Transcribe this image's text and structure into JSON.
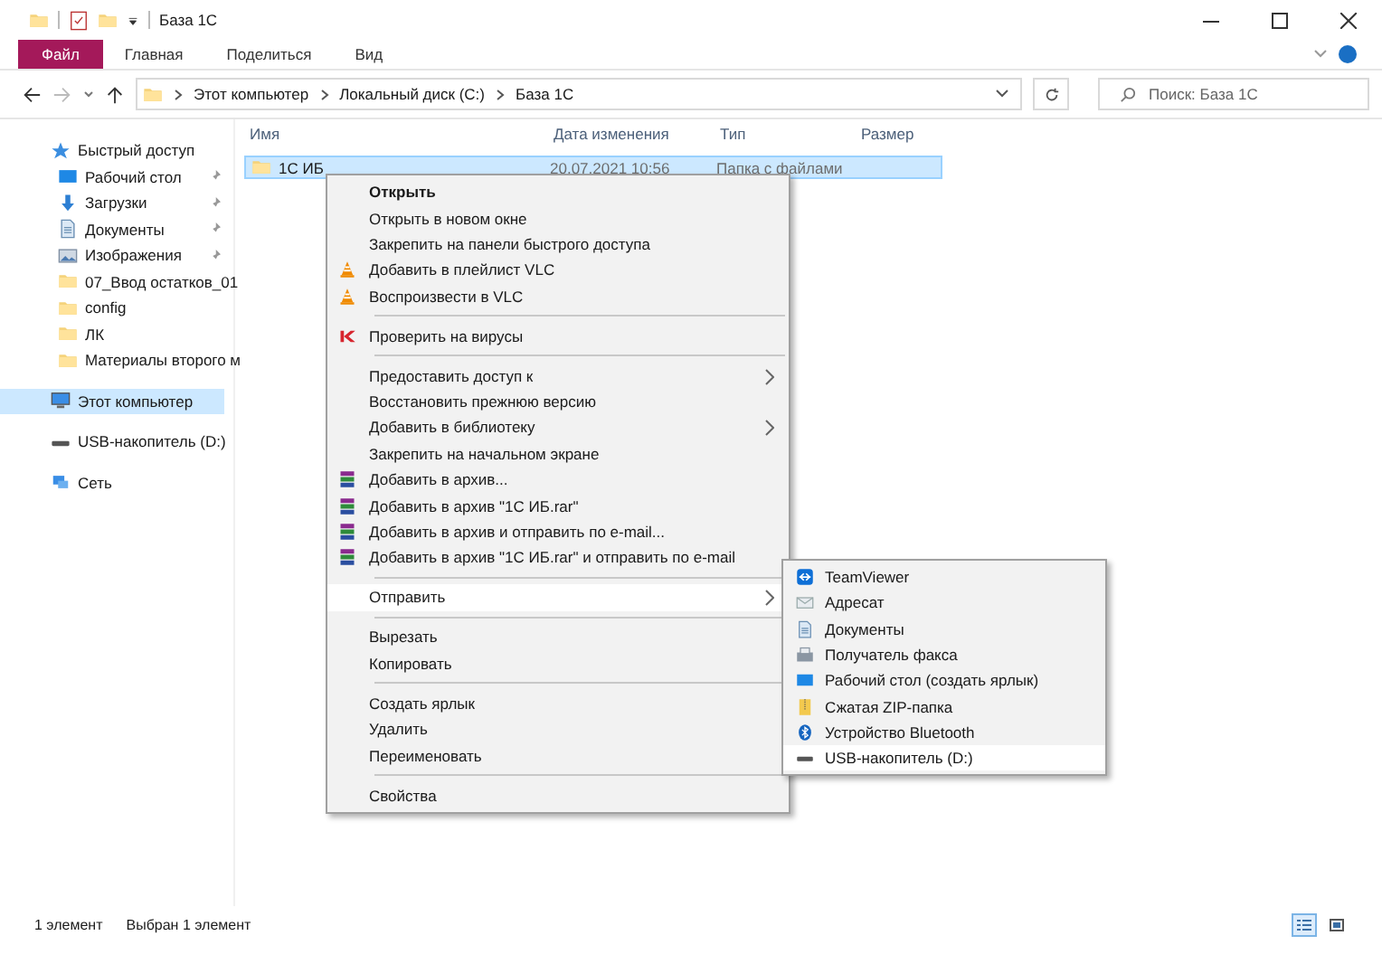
{
  "window": {
    "title": "База 1С"
  },
  "ribbon_tabs": [
    {
      "label": "Файл",
      "selected": true
    },
    {
      "label": "Главная",
      "selected": false
    },
    {
      "label": "Поделиться",
      "selected": false
    },
    {
      "label": "Вид",
      "selected": false
    }
  ],
  "address_bar": {
    "path": [
      "Этот компьютер",
      "Локальный диск (C:)",
      "База 1С"
    ]
  },
  "search": {
    "placeholder": "Поиск: База 1С"
  },
  "sidebar": {
    "items": [
      {
        "label": "Быстрый доступ",
        "selected": false,
        "children": [
          {
            "label": "Рабочий стол",
            "pinned": true,
            "selected": false
          },
          {
            "label": "Загрузки",
            "pinned": true,
            "selected": false
          },
          {
            "label": "Документы",
            "pinned": true,
            "selected": false
          },
          {
            "label": "Изображения",
            "pinned": true,
            "selected": false
          },
          {
            "label": "07_Ввод остатков_01",
            "pinned": false,
            "selected": false
          },
          {
            "label": "config",
            "pinned": false,
            "selected": false
          },
          {
            "label": "ЛК",
            "pinned": false,
            "selected": false
          },
          {
            "label": "Материалы второго м",
            "pinned": false,
            "selected": false
          }
        ]
      },
      {
        "label": "Этот компьютер",
        "selected": true
      },
      {
        "label": "USB-накопитель (D:)",
        "selected": false
      },
      {
        "label": "Сеть",
        "selected": false
      }
    ]
  },
  "table": {
    "columns": [
      "Имя",
      "Дата изменения",
      "Тип",
      "Размер"
    ],
    "rows": [
      {
        "name": "1С ИБ",
        "date": "20.07.2021 10:56",
        "type": "Папка с файлами",
        "selected": true
      }
    ]
  },
  "context_menu": {
    "items": [
      {
        "kind": "default",
        "label": "Открыть",
        "selected": false
      },
      {
        "kind": "item",
        "label": "Открыть в новом окне",
        "selected": false
      },
      {
        "kind": "item",
        "label": "Закрепить на панели быстрого доступа",
        "selected": false
      },
      {
        "kind": "item",
        "label": "Добавить в плейлист VLC",
        "selected": false
      },
      {
        "kind": "item",
        "label": "Воспроизвести в VLC",
        "selected": false
      },
      {
        "kind": "separator"
      },
      {
        "kind": "item",
        "label": "Проверить на вирусы",
        "selected": false
      },
      {
        "kind": "separator"
      },
      {
        "kind": "submenu",
        "label": "Предоставить доступ к",
        "selected": false
      },
      {
        "kind": "item",
        "label": "Восстановить прежнюю версию",
        "selected": false
      },
      {
        "kind": "submenu",
        "label": "Добавить в библиотеку",
        "selected": false
      },
      {
        "kind": "item",
        "label": "Закрепить на начальном экране",
        "selected": false
      },
      {
        "kind": "item",
        "label": "Добавить в архив...",
        "selected": false
      },
      {
        "kind": "item",
        "label": "Добавить в архив \"1С ИБ.rar\"",
        "selected": false
      },
      {
        "kind": "item",
        "label": "Добавить в архив и отправить по e-mail...",
        "selected": false
      },
      {
        "kind": "item",
        "label": "Добавить в архив \"1С ИБ.rar\" и отправить по e-mail",
        "selected": false
      },
      {
        "kind": "separator"
      },
      {
        "kind": "submenu",
        "label": "Отправить",
        "selected": true
      },
      {
        "kind": "separator"
      },
      {
        "kind": "item",
        "label": "Вырезать",
        "selected": false
      },
      {
        "kind": "item",
        "label": "Копировать",
        "selected": false
      },
      {
        "kind": "separator"
      },
      {
        "kind": "item",
        "label": "Создать ярлык",
        "selected": false
      },
      {
        "kind": "item",
        "label": "Удалить",
        "selected": false
      },
      {
        "kind": "item",
        "label": "Переименовать",
        "selected": false
      },
      {
        "kind": "separator"
      },
      {
        "kind": "item",
        "label": "Свойства",
        "selected": false
      }
    ]
  },
  "send_to_menu": {
    "items": [
      {
        "label": "TeamViewer",
        "selected": false
      },
      {
        "label": "Адресат",
        "selected": false
      },
      {
        "label": "Документы",
        "selected": false
      },
      {
        "label": "Получатель факса",
        "selected": false
      },
      {
        "label": "Рабочий стол (создать ярлык)",
        "selected": false
      },
      {
        "label": "Сжатая ZIP-папка",
        "selected": false
      },
      {
        "label": "Устройство Bluetooth",
        "selected": false
      },
      {
        "label": "USB-накопитель (D:)",
        "selected": true
      }
    ]
  },
  "status_bar": {
    "count": "1 элемент",
    "selection": "Выбран 1 элемент"
  }
}
